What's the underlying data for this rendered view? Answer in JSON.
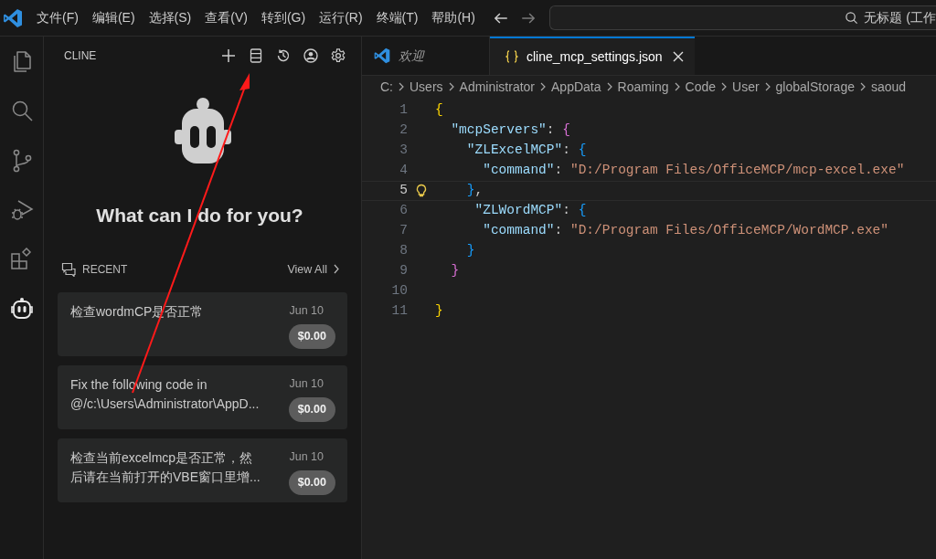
{
  "title_bar": {
    "menus": [
      "文件(F)",
      "编辑(E)",
      "选择(S)",
      "查看(V)",
      "转到(G)",
      "运行(R)",
      "终端(T)",
      "帮助(H)"
    ],
    "search": {
      "value": "无标题 (工作"
    }
  },
  "activity_bar": {
    "items": [
      {
        "kind": "files",
        "selected": false
      },
      {
        "kind": "search",
        "selected": false
      },
      {
        "kind": "git",
        "selected": false
      },
      {
        "kind": "debug",
        "selected": false
      },
      {
        "kind": "extensions",
        "selected": false
      },
      {
        "kind": "robot",
        "selected": true
      }
    ]
  },
  "sidebar": {
    "title": "CLINE",
    "heading": "What can I do for you?",
    "recent_label": "RECENT",
    "view_all": "View All",
    "tasks": [
      {
        "lines": [
          "检查wordmCP是否正常"
        ],
        "date": "Jun 10",
        "cost": "$0.00"
      },
      {
        "lines": [
          "Fix the following code in",
          "@/c:\\Users\\Administrator\\AppD..."
        ],
        "date": "Jun 10",
        "cost": "$0.00"
      },
      {
        "lines": [
          "检查当前excelmcp是否正常，然",
          "后请在当前打开的VBE窗口里增..."
        ],
        "date": "Jun 10",
        "cost": "$0.00"
      }
    ]
  },
  "editor": {
    "tabs": [
      {
        "label": "欢迎",
        "kind": "welcome",
        "selected": false,
        "italic": true
      },
      {
        "label": "cline_mcp_settings.json",
        "kind": "json",
        "selected": true,
        "italic": false
      }
    ],
    "breadcrumbs": [
      "C:",
      "Users",
      "Administrator",
      "AppData",
      "Roaming",
      "Code",
      "User",
      "globalStorage",
      "saoud"
    ],
    "lines": [
      {
        "number": "1",
        "current": false,
        "tokens": [
          {
            "kind": "bracket1",
            "text": "{"
          }
        ]
      },
      {
        "number": "2",
        "current": false,
        "tokens": [
          {
            "kind": "key",
            "text": "  \"mcpServers\""
          },
          {
            "kind": "punct",
            "text": ": "
          },
          {
            "kind": "bracket2",
            "text": "{"
          }
        ]
      },
      {
        "number": "3",
        "current": false,
        "tokens": [
          {
            "kind": "key",
            "text": "    \"ZLExcelMCP\""
          },
          {
            "kind": "punct",
            "text": ": "
          },
          {
            "kind": "bracket3",
            "text": "{"
          }
        ]
      },
      {
        "number": "4",
        "current": false,
        "tokens": [
          {
            "kind": "key",
            "text": "      \"command\""
          },
          {
            "kind": "punct",
            "text": ": "
          },
          {
            "kind": "string",
            "text": "\"D:/Program Files/OfficeMCP/mcp-excel.exe\""
          }
        ]
      },
      {
        "number": "5",
        "current": true,
        "tokens": [
          {
            "kind": "bracket3",
            "text": "    }"
          },
          {
            "kind": "punct",
            "text": ","
          }
        ]
      },
      {
        "number": "6",
        "current": false,
        "tokens": [
          {
            "kind": "key",
            "text": "     \"ZLWordMCP\""
          },
          {
            "kind": "punct",
            "text": ": "
          },
          {
            "kind": "bracket3",
            "text": "{"
          }
        ]
      },
      {
        "number": "7",
        "current": false,
        "tokens": [
          {
            "kind": "key",
            "text": "      \"command\""
          },
          {
            "kind": "punct",
            "text": ": "
          },
          {
            "kind": "string",
            "text": "\"D:/Program Files/OfficeMCP/WordMCP.exe\""
          }
        ]
      },
      {
        "number": "8",
        "current": false,
        "tokens": [
          {
            "kind": "bracket3",
            "text": "    }"
          }
        ]
      },
      {
        "number": "9",
        "current": false,
        "tokens": [
          {
            "kind": "bracket2",
            "text": "  }"
          }
        ]
      },
      {
        "number": "10",
        "current": false
      },
      {
        "number": "11",
        "current": false,
        "tokens": [
          {
            "kind": "bracket1",
            "text": "}"
          }
        ]
      }
    ]
  },
  "annotation": {
    "kind": "arrow"
  }
}
